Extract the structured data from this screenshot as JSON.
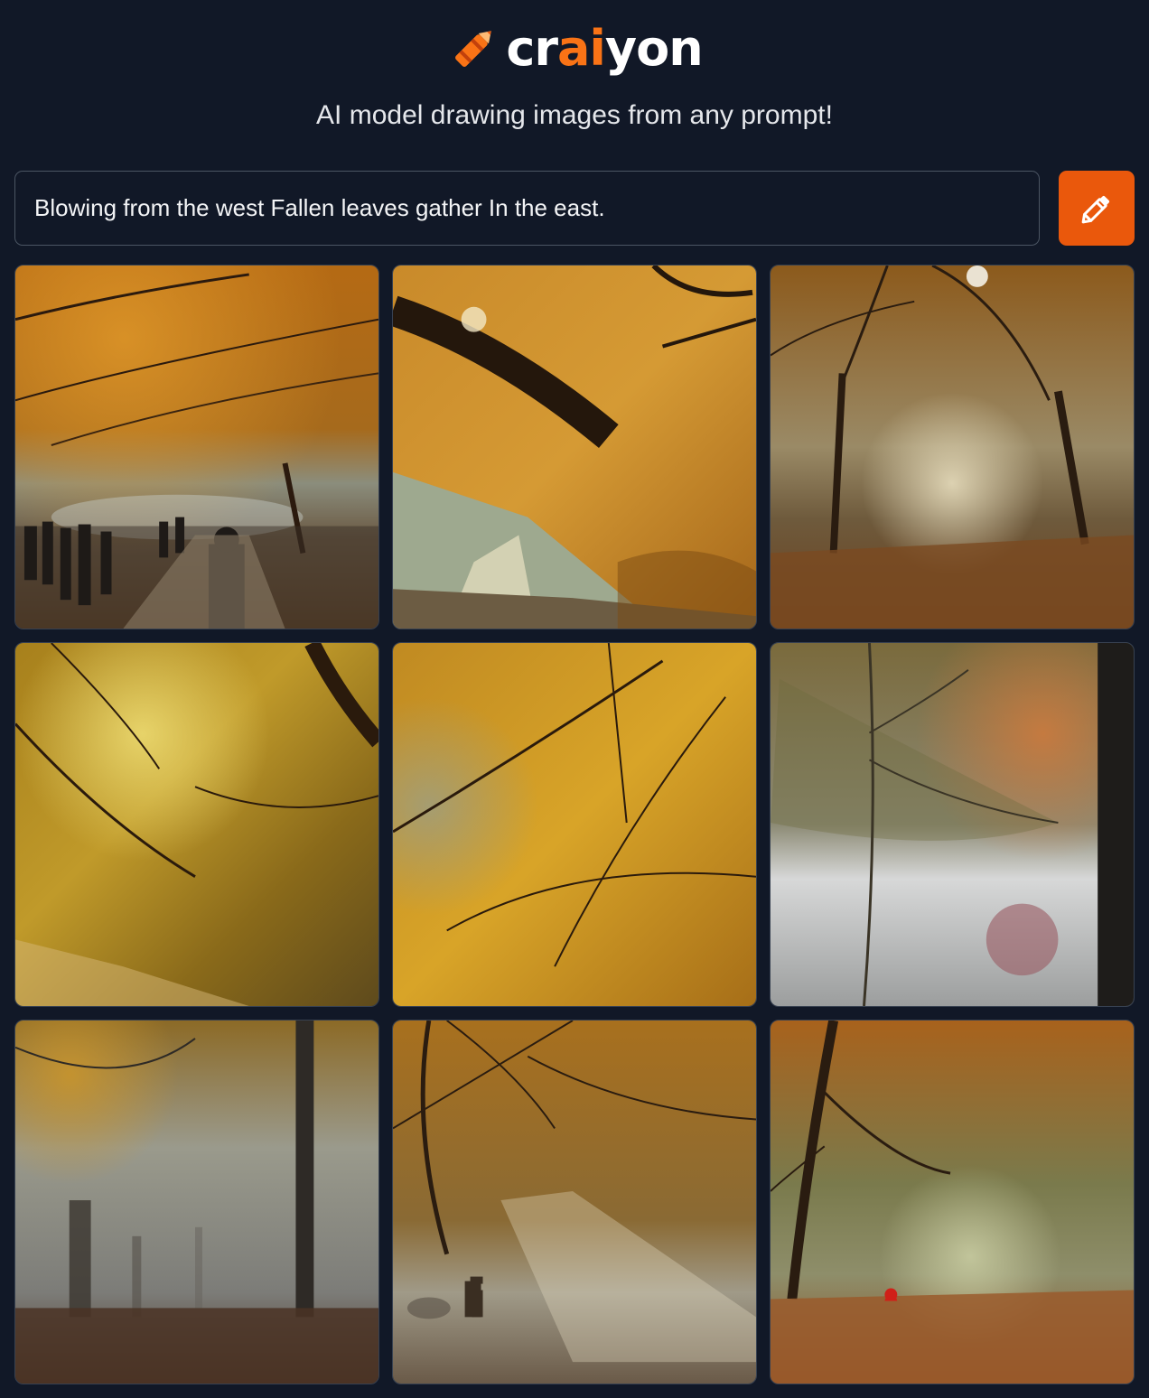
{
  "header": {
    "logo_text_start": "cr",
    "logo_text_accent": "ai",
    "logo_text_end": "yon",
    "tagline": "AI model drawing images from any prompt!"
  },
  "prompt": {
    "value": "Blowing from the west Fallen leaves gather In the east."
  },
  "draw_button": {
    "icon": "pencil-icon"
  },
  "colors": {
    "background": "#111827",
    "accent": "#ea580c",
    "logo_accent": "#f97316"
  },
  "results": [
    {
      "scene": "autumn-park-path-with-people"
    },
    {
      "scene": "golden-branch-over-misty-road"
    },
    {
      "scene": "misty-tree-lined-alley"
    },
    {
      "scene": "golden-canopy-looking-up"
    },
    {
      "scene": "yellow-leaves-and-branches"
    },
    {
      "scene": "foggy-leaf-with-trunk"
    },
    {
      "scene": "foggy-forest-with-trunks"
    },
    {
      "scene": "sunbeams-over-park-path"
    },
    {
      "scene": "tree-and-leaf-covered-ground"
    }
  ]
}
